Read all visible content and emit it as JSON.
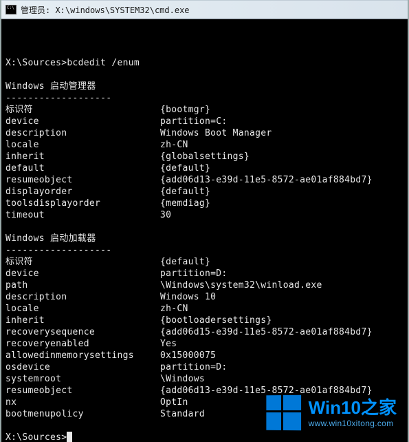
{
  "titlebar": {
    "label": "管理员: X:\\windows\\SYSTEM32\\cmd.exe"
  },
  "prompt1": "X:\\Sources>",
  "command": "bcdedit /enum",
  "sections": {
    "bootmgr": {
      "title": "Windows 启动管理器",
      "rule": "-------------------",
      "rows": [
        {
          "k": "标识符",
          "v": "{bootmgr}"
        },
        {
          "k": "device",
          "v": "partition=C:"
        },
        {
          "k": "description",
          "v": "Windows Boot Manager"
        },
        {
          "k": "locale",
          "v": "zh-CN"
        },
        {
          "k": "inherit",
          "v": "{globalsettings}"
        },
        {
          "k": "default",
          "v": "{default}"
        },
        {
          "k": "resumeobject",
          "v": "{add06d13-e39d-11e5-8572-ae01af884bd7}"
        },
        {
          "k": "displayorder",
          "v": "{default}"
        },
        {
          "k": "toolsdisplayorder",
          "v": "{memdiag}"
        },
        {
          "k": "timeout",
          "v": "30"
        }
      ]
    },
    "loader": {
      "title": "Windows 启动加载器",
      "rule": "-------------------",
      "rows": [
        {
          "k": "标识符",
          "v": "{default}"
        },
        {
          "k": "device",
          "v": "partition=D:"
        },
        {
          "k": "path",
          "v": "\\Windows\\system32\\winload.exe"
        },
        {
          "k": "description",
          "v": "Windows 10"
        },
        {
          "k": "locale",
          "v": "zh-CN"
        },
        {
          "k": "inherit",
          "v": "{bootloadersettings}"
        },
        {
          "k": "recoverysequence",
          "v": "{add06d15-e39d-11e5-8572-ae01af884bd7}"
        },
        {
          "k": "recoveryenabled",
          "v": "Yes"
        },
        {
          "k": "allowedinmemorysettings",
          "v": "0x15000075"
        },
        {
          "k": "osdevice",
          "v": "partition=D:"
        },
        {
          "k": "systemroot",
          "v": "\\Windows"
        },
        {
          "k": "resumeobject",
          "v": "{add06d13-e39d-11e5-8572-ae01af884bd7}"
        },
        {
          "k": "nx",
          "v": "OptIn"
        },
        {
          "k": "bootmenupolicy",
          "v": "Standard"
        }
      ]
    }
  },
  "prompt2": "X:\\Sources>",
  "watermark": {
    "main": "Win10之家",
    "sub": "www.win10xitong.com"
  }
}
